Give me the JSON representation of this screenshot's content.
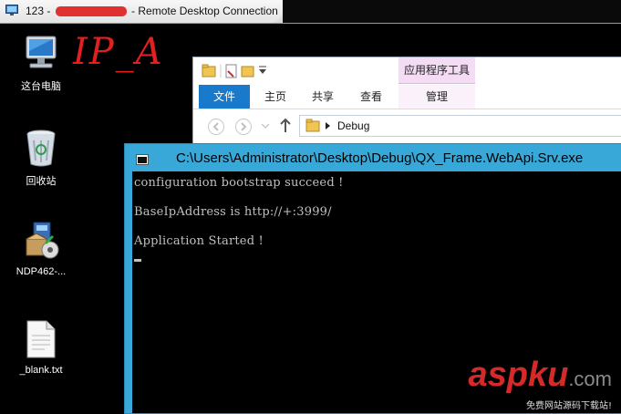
{
  "window": {
    "title_prefix": "123 -",
    "title_suffix": "- Remote Desktop Connection"
  },
  "annotation": "IP_A",
  "desktop_icons": [
    {
      "label": "这台电脑",
      "icon": "computer-icon"
    },
    {
      "label": "回收站",
      "icon": "recycle-bin-icon"
    },
    {
      "label": "NDP462-...",
      "icon": "installer-icon"
    },
    {
      "label": "_blank.txt",
      "icon": "text-file-icon"
    }
  ],
  "explorer": {
    "context_tab": "应用程序工具",
    "tabs": [
      "文件",
      "主页",
      "共享",
      "查看",
      "管理"
    ],
    "address": "Debug"
  },
  "console": {
    "title": "C:\\Users\\Administrator\\Desktop\\Debug\\QX_Frame.WebApi.Srv.exe",
    "lines": [
      "configuration bootstrap succeed !",
      "BaseIpAddress is http://+:3999/",
      "Application Started !"
    ]
  },
  "watermark": {
    "brand": "aspku",
    "domain": ".com",
    "tagline": "免费网站源码下载站!"
  },
  "colors": {
    "console_frame": "#38a8d8",
    "file_tab": "#1979ca",
    "context_tab": "#f3dcf4",
    "annotation": "#e32020"
  }
}
